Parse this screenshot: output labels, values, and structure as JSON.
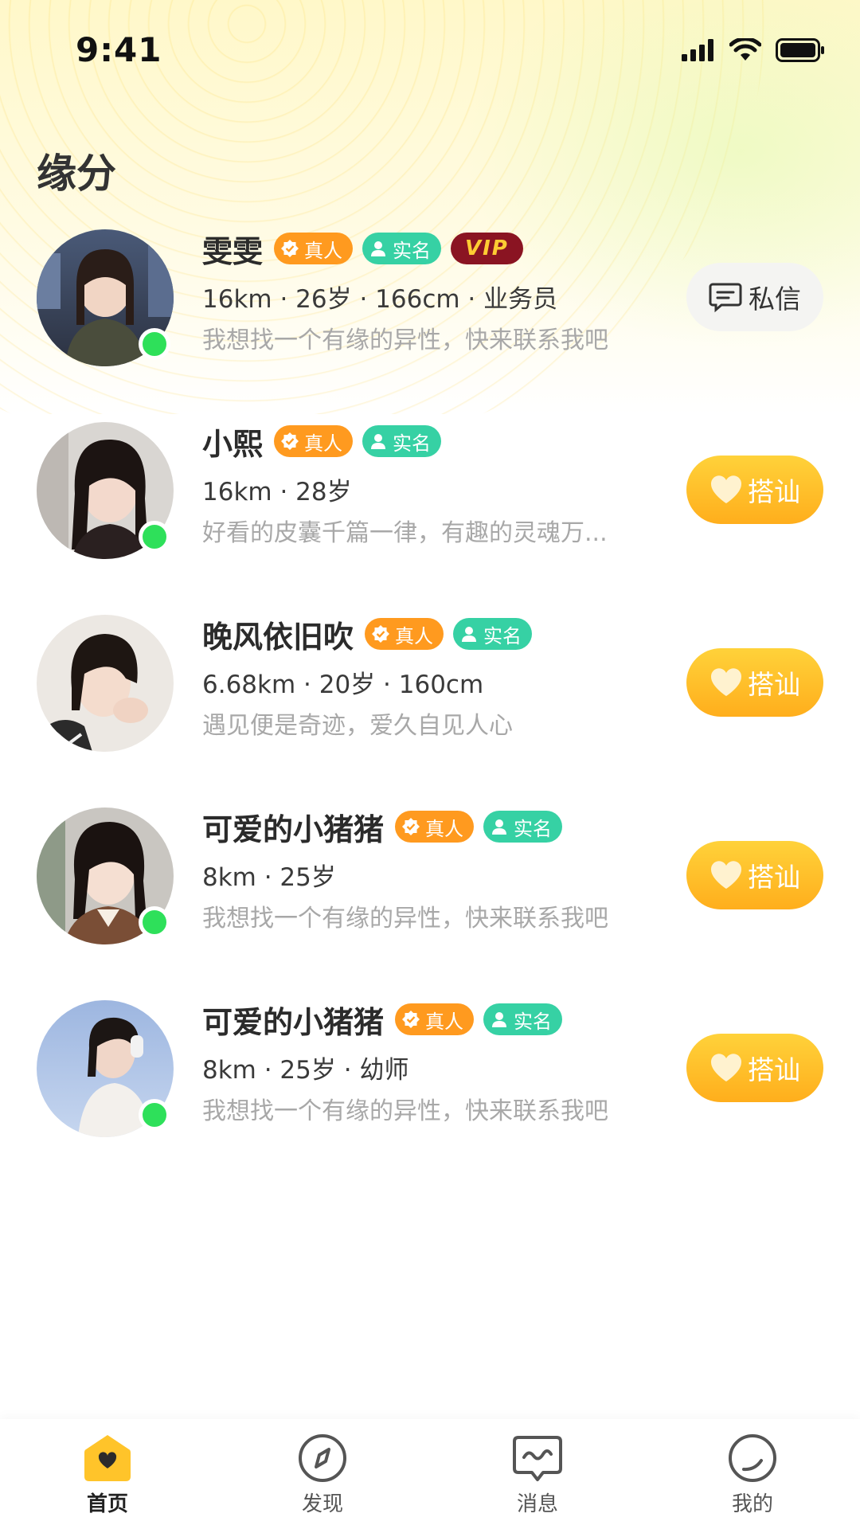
{
  "status_bar": {
    "time": "9:41"
  },
  "page": {
    "title": "缘分"
  },
  "badges": {
    "real": "真人",
    "realname": "实名",
    "vip": "VIP"
  },
  "actions": {
    "chat": "私信",
    "greet": "搭讪"
  },
  "users": [
    {
      "name": "雯雯",
      "details": "16km · 26岁 · 166cm · 业务员",
      "bio": "我想找一个有缘的异性，快来联系我吧",
      "vip": true,
      "online": true,
      "action": "chat"
    },
    {
      "name": "小熙",
      "details": "16km · 28岁",
      "bio": "好看的皮囊千篇一律，有趣的灵魂万...",
      "vip": false,
      "online": true,
      "action": "greet"
    },
    {
      "name": "晚风依旧吹",
      "details": "6.68km · 20岁 · 160cm",
      "bio": "遇见便是奇迹，爱久自见人心",
      "vip": false,
      "online": false,
      "action": "greet"
    },
    {
      "name": "可爱的小猪猪",
      "details": "8km · 25岁",
      "bio": "我想找一个有缘的异性，快来联系我吧",
      "vip": false,
      "online": true,
      "action": "greet"
    },
    {
      "name": "可爱的小猪猪",
      "details": "8km · 25岁 · 幼师",
      "bio": "我想找一个有缘的异性，快来联系我吧",
      "vip": false,
      "online": true,
      "action": "greet"
    }
  ],
  "tabs": [
    {
      "label": "首页",
      "icon": "home-icon",
      "active": true
    },
    {
      "label": "发现",
      "icon": "compass-icon",
      "active": false
    },
    {
      "label": "消息",
      "icon": "message-icon",
      "active": false
    },
    {
      "label": "我的",
      "icon": "profile-icon",
      "active": false
    }
  ],
  "colors": {
    "accent": "#ffb020",
    "badge_real": "#ff9a1f",
    "badge_realname": "#36d1a4",
    "badge_vip_bg": "#8a1422",
    "online": "#2ee05a"
  }
}
